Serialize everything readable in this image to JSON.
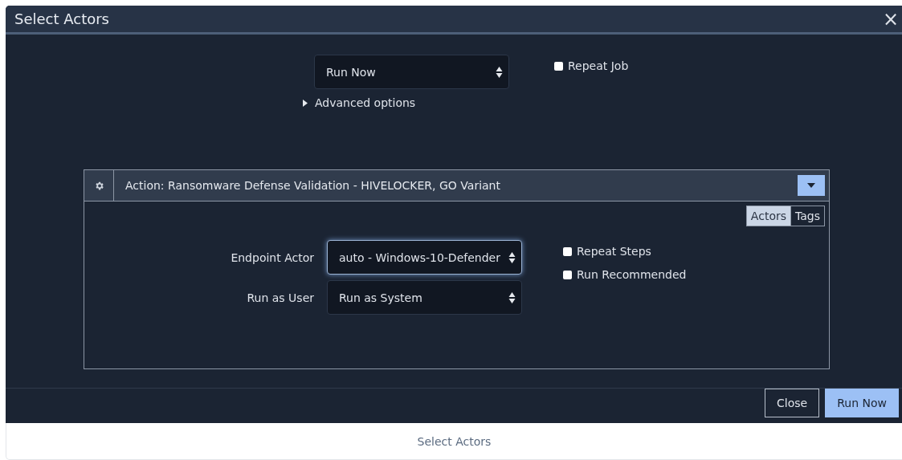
{
  "dialog": {
    "title": "Select Actors",
    "close": "×"
  },
  "schedule": {
    "select": {
      "value": "Run Now"
    },
    "advanced": {
      "label": "Advanced options",
      "expanded": false
    },
    "checkbox": {
      "label": "Repeat Job",
      "checked": false
    }
  },
  "action": {
    "title": "Action: Ransomware Defense Validation - HIVELOCKER, GO Variant",
    "expanded": false,
    "tabs": [
      {
        "label": "Actors",
        "selected": true
      },
      {
        "label": "Tags",
        "selected": false
      }
    ],
    "fields": [
      {
        "label": "Endpoint Actor",
        "value": "auto - Windows-10-Defender",
        "focused": true
      },
      {
        "label": "Run as User",
        "value": "Run as System",
        "focused": false
      }
    ],
    "checkboxes": [
      {
        "label": "Repeat Steps",
        "checked": false
      },
      {
        "label": "Run Recommended",
        "checked": false
      }
    ]
  },
  "buttons": [
    {
      "label": "Close",
      "kind": "secondary"
    },
    {
      "label": "Run Now",
      "kind": "primary"
    }
  ],
  "caption": "Select Actors"
}
